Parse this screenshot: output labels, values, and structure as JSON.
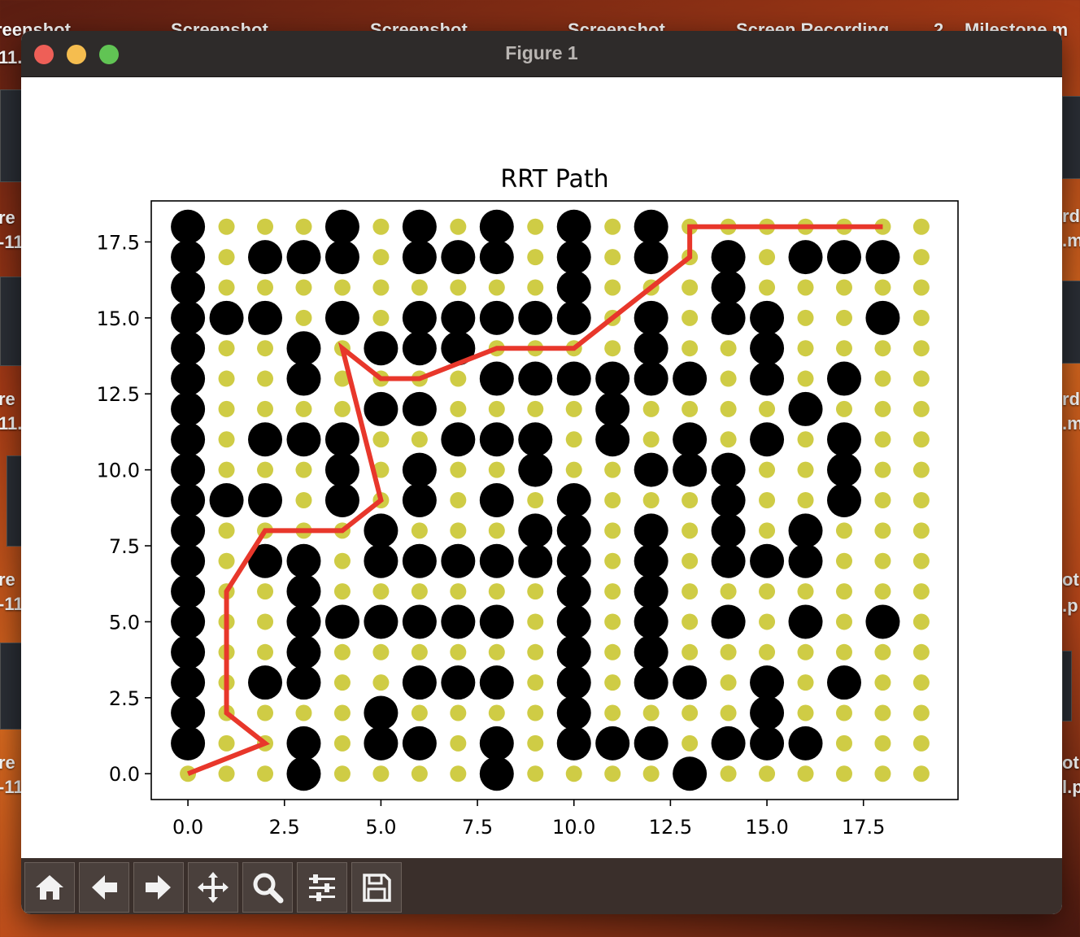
{
  "desktop": {
    "labels_top": [
      "reenshot",
      "Screenshot",
      "Screenshot",
      "Screenshot",
      "Screen Recording",
      "2",
      "Milestone.m"
    ],
    "labels_left": [
      "11.",
      "re",
      "-11",
      "re",
      "11.",
      "re",
      "-11",
      "re",
      "-11"
    ],
    "labels_right": [
      "rdi",
      ".m",
      "rdi",
      ".m",
      "ot",
      ".p",
      "ot",
      "l.p"
    ]
  },
  "window": {
    "title": "Figure 1",
    "toolbar": [
      {
        "icon": "home-icon",
        "label": "Home"
      },
      {
        "icon": "back-arrow-icon",
        "label": "Back"
      },
      {
        "icon": "forward-arrow-icon",
        "label": "Forward"
      },
      {
        "icon": "pan-icon",
        "label": "Pan"
      },
      {
        "icon": "zoom-icon",
        "label": "Zoom"
      },
      {
        "icon": "configure-subplots-icon",
        "label": "Configure subplots"
      },
      {
        "icon": "save-icon",
        "label": "Save"
      }
    ]
  },
  "chart_data": {
    "type": "scatter",
    "title": "RRT Path",
    "xlabel": "",
    "ylabel": "",
    "xlim": [
      -0.95,
      19.95
    ],
    "ylim": [
      -0.85,
      18.85
    ],
    "xticks": [
      0.0,
      2.5,
      5.0,
      7.5,
      10.0,
      12.5,
      15.0,
      17.5
    ],
    "yticks": [
      0.0,
      2.5,
      5.0,
      7.5,
      10.0,
      12.5,
      15.0,
      17.5
    ],
    "xtick_labels": [
      "0.0",
      "2.5",
      "5.0",
      "7.5",
      "10.0",
      "12.5",
      "15.0",
      "17.5"
    ],
    "ytick_labels": [
      "0.0",
      "2.5",
      "5.0",
      "7.5",
      "10.0",
      "12.5",
      "15.0",
      "17.5"
    ],
    "grid": false,
    "colors": {
      "free": "#cfcc45",
      "obstacle": "#000000",
      "path": "#e8372b"
    },
    "free_grid": {
      "x_range": [
        0,
        19
      ],
      "y_range": [
        0,
        18
      ]
    },
    "obstacles": [
      [
        0,
        1
      ],
      [
        0,
        2
      ],
      [
        0,
        3
      ],
      [
        0,
        4
      ],
      [
        0,
        5
      ],
      [
        0,
        6
      ],
      [
        0,
        7
      ],
      [
        0,
        8
      ],
      [
        0,
        9
      ],
      [
        0,
        10
      ],
      [
        0,
        11
      ],
      [
        0,
        12
      ],
      [
        0,
        13
      ],
      [
        0,
        14
      ],
      [
        0,
        15
      ],
      [
        0,
        16
      ],
      [
        0,
        17
      ],
      [
        0,
        18
      ],
      [
        1,
        9
      ],
      [
        1,
        15
      ],
      [
        2,
        3
      ],
      [
        2,
        7
      ],
      [
        2,
        9
      ],
      [
        2,
        11
      ],
      [
        2,
        15
      ],
      [
        2,
        17
      ],
      [
        3,
        0
      ],
      [
        3,
        1
      ],
      [
        3,
        3
      ],
      [
        3,
        4
      ],
      [
        3,
        5
      ],
      [
        3,
        6
      ],
      [
        3,
        7
      ],
      [
        3,
        11
      ],
      [
        3,
        13
      ],
      [
        3,
        14
      ],
      [
        3,
        17
      ],
      [
        4,
        5
      ],
      [
        4,
        9
      ],
      [
        4,
        10
      ],
      [
        4,
        11
      ],
      [
        4,
        15
      ],
      [
        4,
        17
      ],
      [
        4,
        18
      ],
      [
        5,
        1
      ],
      [
        5,
        2
      ],
      [
        5,
        5
      ],
      [
        5,
        7
      ],
      [
        5,
        8
      ],
      [
        5,
        12
      ],
      [
        5,
        14
      ],
      [
        6,
        1
      ],
      [
        6,
        3
      ],
      [
        6,
        5
      ],
      [
        6,
        7
      ],
      [
        6,
        9
      ],
      [
        6,
        10
      ],
      [
        6,
        12
      ],
      [
        6,
        14
      ],
      [
        6,
        15
      ],
      [
        6,
        17
      ],
      [
        6,
        18
      ],
      [
        7,
        3
      ],
      [
        7,
        5
      ],
      [
        7,
        7
      ],
      [
        7,
        11
      ],
      [
        7,
        14
      ],
      [
        7,
        15
      ],
      [
        7,
        17
      ],
      [
        8,
        0
      ],
      [
        8,
        1
      ],
      [
        8,
        3
      ],
      [
        8,
        5
      ],
      [
        8,
        7
      ],
      [
        8,
        9
      ],
      [
        8,
        11
      ],
      [
        8,
        13
      ],
      [
        8,
        15
      ],
      [
        8,
        17
      ],
      [
        8,
        18
      ],
      [
        9,
        7
      ],
      [
        9,
        8
      ],
      [
        9,
        10
      ],
      [
        9,
        11
      ],
      [
        9,
        13
      ],
      [
        9,
        15
      ],
      [
        10,
        1
      ],
      [
        10,
        2
      ],
      [
        10,
        3
      ],
      [
        10,
        4
      ],
      [
        10,
        5
      ],
      [
        10,
        6
      ],
      [
        10,
        7
      ],
      [
        10,
        8
      ],
      [
        10,
        9
      ],
      [
        10,
        13
      ],
      [
        10,
        15
      ],
      [
        10,
        16
      ],
      [
        10,
        17
      ],
      [
        10,
        18
      ],
      [
        11,
        1
      ],
      [
        11,
        11
      ],
      [
        11,
        12
      ],
      [
        11,
        13
      ],
      [
        12,
        1
      ],
      [
        12,
        3
      ],
      [
        12,
        4
      ],
      [
        12,
        5
      ],
      [
        12,
        6
      ],
      [
        12,
        7
      ],
      [
        12,
        8
      ],
      [
        12,
        10
      ],
      [
        12,
        13
      ],
      [
        12,
        14
      ],
      [
        12,
        15
      ],
      [
        12,
        17
      ],
      [
        12,
        18
      ],
      [
        13,
        0
      ],
      [
        13,
        3
      ],
      [
        13,
        10
      ],
      [
        13,
        11
      ],
      [
        13,
        13
      ],
      [
        14,
        1
      ],
      [
        14,
        5
      ],
      [
        14,
        7
      ],
      [
        14,
        8
      ],
      [
        14,
        9
      ],
      [
        14,
        10
      ],
      [
        14,
        15
      ],
      [
        14,
        16
      ],
      [
        14,
        17
      ],
      [
        15,
        1
      ],
      [
        15,
        2
      ],
      [
        15,
        3
      ],
      [
        15,
        7
      ],
      [
        15,
        11
      ],
      [
        15,
        13
      ],
      [
        15,
        14
      ],
      [
        15,
        15
      ],
      [
        16,
        1
      ],
      [
        16,
        5
      ],
      [
        16,
        7
      ],
      [
        16,
        8
      ],
      [
        16,
        12
      ],
      [
        16,
        17
      ],
      [
        17,
        3
      ],
      [
        17,
        9
      ],
      [
        17,
        10
      ],
      [
        17,
        11
      ],
      [
        17,
        13
      ],
      [
        17,
        17
      ],
      [
        18,
        5
      ],
      [
        18,
        15
      ],
      [
        18,
        17
      ]
    ],
    "path": [
      [
        0,
        0
      ],
      [
        2,
        1
      ],
      [
        1,
        2
      ],
      [
        1,
        6
      ],
      [
        2,
        8
      ],
      [
        4,
        8
      ],
      [
        5,
        9
      ],
      [
        4,
        14
      ],
      [
        5,
        13
      ],
      [
        6,
        13
      ],
      [
        8,
        14
      ],
      [
        10,
        14
      ],
      [
        12,
        16
      ],
      [
        13,
        17
      ],
      [
        13,
        18
      ],
      [
        18,
        18
      ]
    ]
  }
}
